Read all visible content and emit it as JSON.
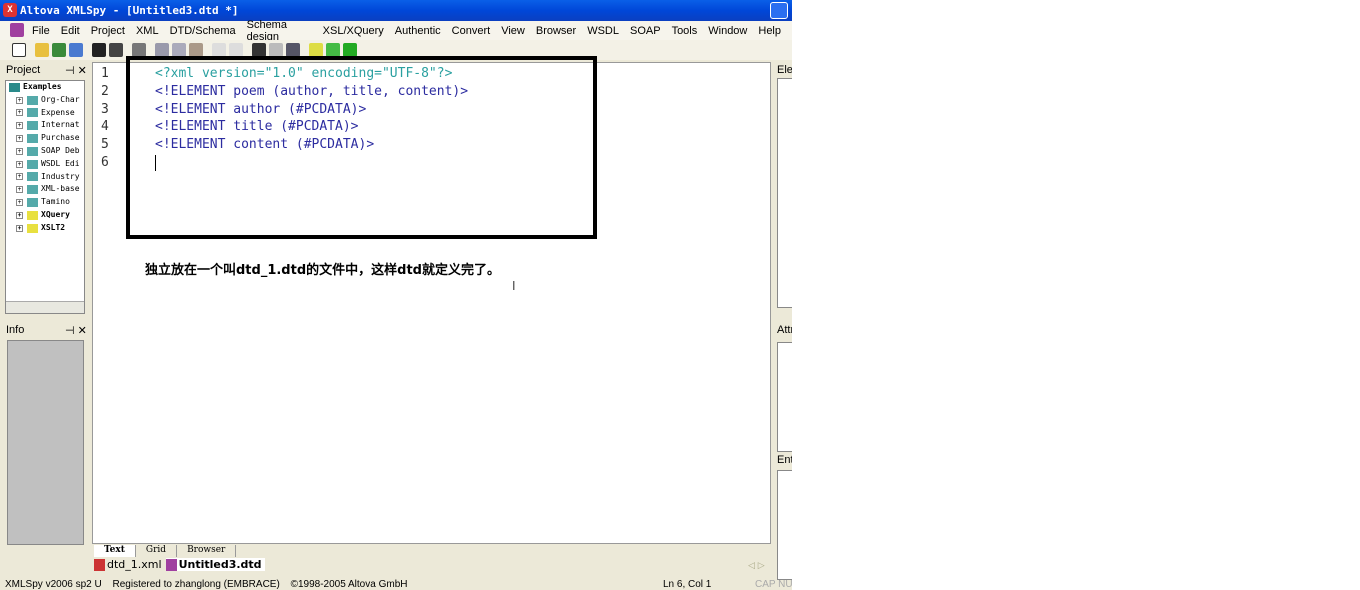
{
  "window": {
    "title": "Altova XMLSpy - [Untitled3.dtd *]"
  },
  "menu": [
    "File",
    "Edit",
    "Project",
    "XML",
    "DTD/Schema",
    "Schema design",
    "XSL/XQuery",
    "Authentic",
    "Convert",
    "View",
    "Browser",
    "WSDL",
    "SOAP",
    "Tools",
    "Window",
    "Help"
  ],
  "project": {
    "title": "Project",
    "root": "Examples",
    "items": [
      "Org-Char",
      "Expense",
      "Internat",
      "Purchase",
      "SOAP Deb",
      "WSDL Edi",
      "Industry",
      "XML-base",
      "Tamino"
    ],
    "bold_items": [
      "XQuery",
      "XSLT2"
    ]
  },
  "info": {
    "title": "Info"
  },
  "editor": {
    "line_numbers": [
      "1",
      "2",
      "3",
      "4",
      "5",
      "6"
    ],
    "lines": [
      "<?xml version=\"1.0\" encoding=\"UTF-8\"?>",
      "<!ELEMENT poem (author, title, content)>",
      "<!ELEMENT author (#PCDATA)>",
      "<!ELEMENT title (#PCDATA)>",
      "<!ELEMENT content (#PCDATA)>",
      ""
    ]
  },
  "caption": "独立放在一个叫dtd_1.dtd的文件中，这样dtd就定义完了。",
  "view_tabs": [
    "Text",
    "Grid",
    "Browser"
  ],
  "file_tabs": [
    "dtd_1.xml",
    "Untitled3.dtd"
  ],
  "right_panels": [
    "Elements",
    "Attributes",
    "Entities"
  ],
  "status": {
    "version": "XMLSpy v2006 sp2 U",
    "registered": "Registered to zhanglong (EMBRACE)",
    "copyright": "©1998-2005 Altova GmbH",
    "position": "Ln 6, Col 1",
    "caps": "CAP NUM"
  }
}
